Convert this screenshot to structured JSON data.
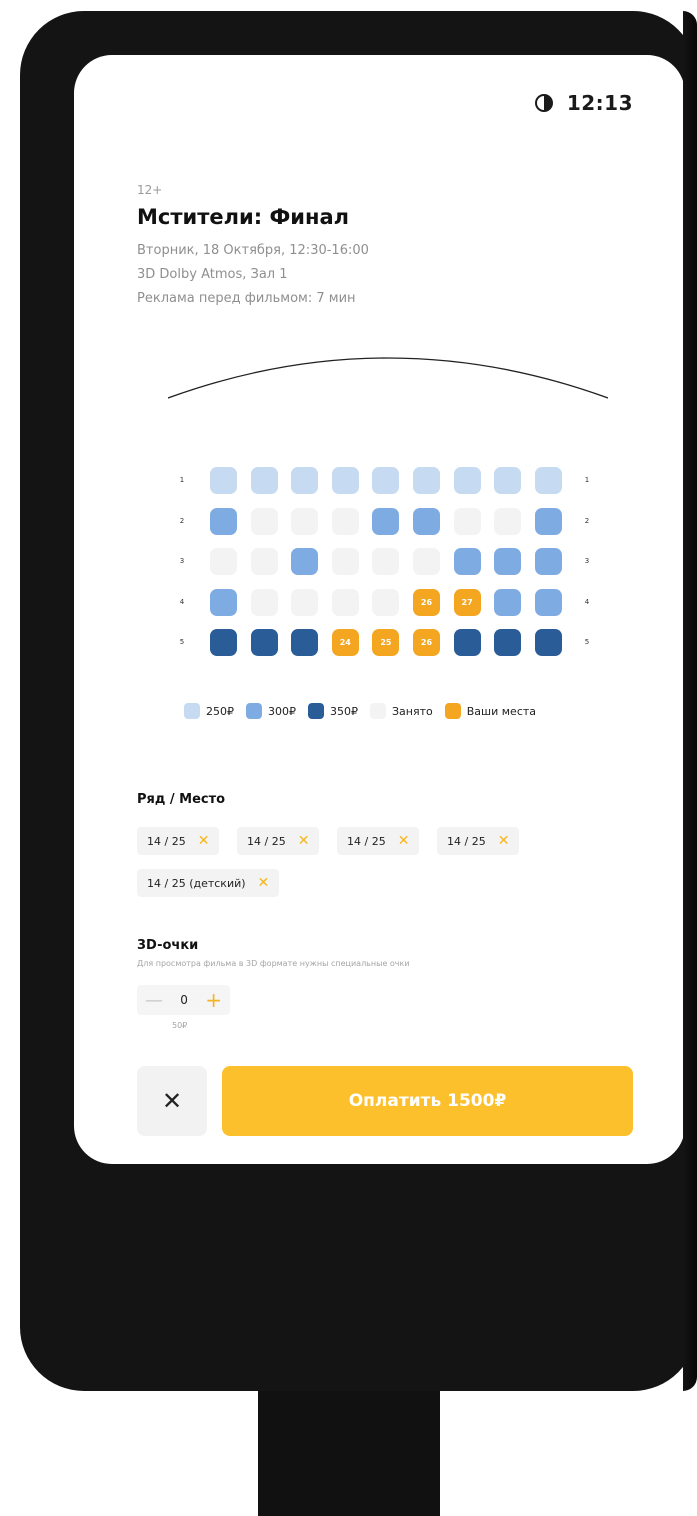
{
  "status": {
    "time": "12:13",
    "theme_icon": "contrast-icon"
  },
  "movie": {
    "age_rating": "12+",
    "title": "Мстители: Финал",
    "datetime": "Вторник, 18 Октября, 12:30-16:00",
    "format": "3D Dolby Atmos, Зал 1",
    "ads": "Реклама перед фильмом: 7 мин"
  },
  "colors": {
    "p250": "#c6daf2",
    "p300": "#7fabe3",
    "p350": "#2a5c97",
    "taken": "#f3f3f3",
    "mine": "#f4a621",
    "accent": "#fdc02d"
  },
  "hall": {
    "rows": [
      {
        "label": "1",
        "seats": [
          [
            "p250",
            ""
          ],
          [
            "p250",
            ""
          ],
          [
            "p250",
            ""
          ],
          [
            "p250",
            ""
          ],
          [
            "p250",
            ""
          ],
          [
            "p250",
            ""
          ],
          [
            "p250",
            ""
          ],
          [
            "p250",
            ""
          ],
          [
            "p250",
            ""
          ]
        ]
      },
      {
        "label": "2",
        "seats": [
          [
            "p300",
            ""
          ],
          [
            "taken",
            ""
          ],
          [
            "taken",
            ""
          ],
          [
            "taken",
            ""
          ],
          [
            "p300",
            ""
          ],
          [
            "p300",
            ""
          ],
          [
            "taken",
            ""
          ],
          [
            "taken",
            ""
          ],
          [
            "p300",
            ""
          ]
        ]
      },
      {
        "label": "3",
        "seats": [
          [
            "taken",
            ""
          ],
          [
            "taken",
            ""
          ],
          [
            "p300",
            ""
          ],
          [
            "taken",
            ""
          ],
          [
            "taken",
            ""
          ],
          [
            "taken",
            ""
          ],
          [
            "p300",
            ""
          ],
          [
            "p300",
            ""
          ],
          [
            "p300",
            ""
          ]
        ]
      },
      {
        "label": "4",
        "seats": [
          [
            "p300",
            ""
          ],
          [
            "taken",
            ""
          ],
          [
            "taken",
            ""
          ],
          [
            "taken",
            ""
          ],
          [
            "taken",
            ""
          ],
          [
            "mine",
            "26"
          ],
          [
            "mine",
            "27"
          ],
          [
            "p300",
            ""
          ],
          [
            "p300",
            ""
          ]
        ]
      },
      {
        "label": "5",
        "seats": [
          [
            "p350",
            ""
          ],
          [
            "p350",
            ""
          ],
          [
            "p350",
            ""
          ],
          [
            "mine",
            "24"
          ],
          [
            "mine",
            "25"
          ],
          [
            "mine",
            "26"
          ],
          [
            "p350",
            ""
          ],
          [
            "p350",
            ""
          ],
          [
            "p350",
            ""
          ]
        ]
      }
    ]
  },
  "legend": [
    {
      "key": "p250",
      "label": "250₽"
    },
    {
      "key": "p300",
      "label": "300₽"
    },
    {
      "key": "p350",
      "label": "350₽"
    },
    {
      "key": "taken",
      "label": "Занято"
    },
    {
      "key": "mine",
      "label": "Ваши места"
    }
  ],
  "selection": {
    "title": "Ряд / Место",
    "chips": [
      "14 / 25",
      "14 / 25",
      "14 / 25",
      "14 / 25",
      "14 / 25 (детский)"
    ]
  },
  "glasses": {
    "title": "3D-очки",
    "description": "Для просмотра фильма в 3D формате нужны специальные очки",
    "minus": "—",
    "value": "0",
    "plus": "+",
    "price": "50₽"
  },
  "actions": {
    "close": "✕",
    "pay": "Оплатить 1500₽"
  }
}
